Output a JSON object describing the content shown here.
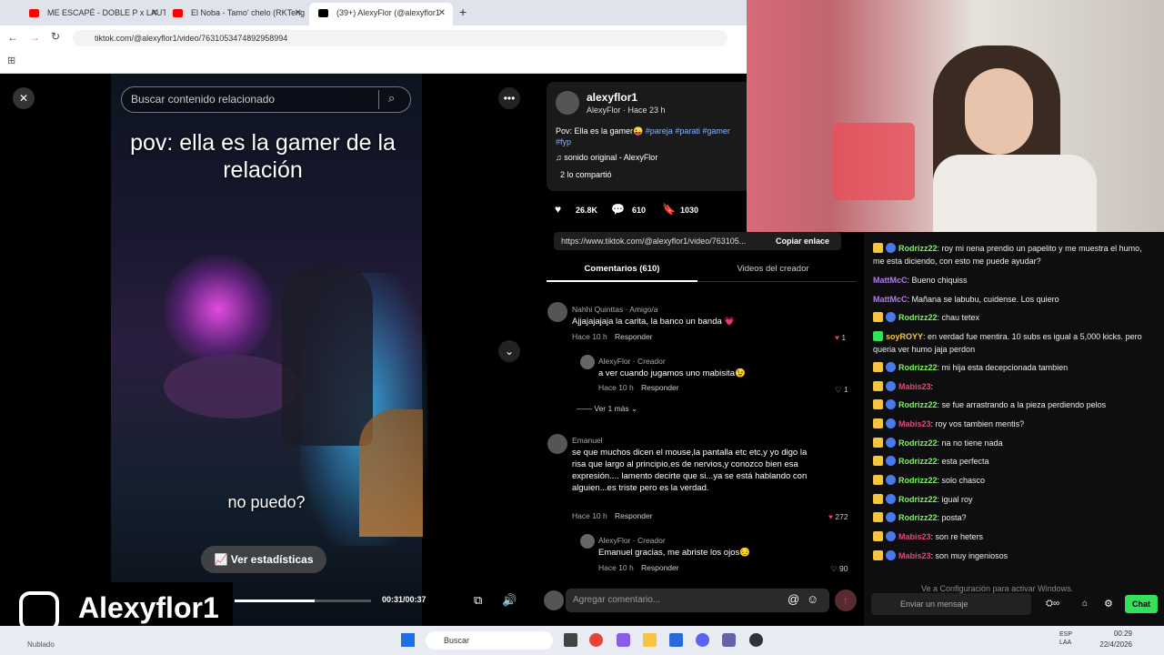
{
  "browser": {
    "tabs": [
      {
        "label": "ME ESCAPÉ - DOBLE P x LAUTY",
        "color": "#ff0000"
      },
      {
        "label": "El Noba - Tamo' chelo (RKTeng",
        "color": "#ff0000"
      },
      {
        "label": "(39+) AlexyFlor (@alexyflor1",
        "color": "#000000"
      }
    ],
    "url": "tiktok.com/@alexyflor1/video/7631053474892958994"
  },
  "tiktok": {
    "search_placeholder": "Buscar contenido relacionado",
    "video_caption": "pov: ella es la gamer de la relación",
    "video_subtitle": "no puedo?",
    "stats_button": "Ver estadísticas",
    "time": "00:31/00:37",
    "progress": 0.84,
    "author": {
      "name": "alexyflor1",
      "sub": "AlexyFlor · Hace 23 h"
    },
    "desc": "Pov: Ella es la gamer😜",
    "tags": [
      "#pareja",
      "#parati",
      "#gamer",
      "#fyp"
    ],
    "sound": "sonido original - AlexyFlor",
    "shared": "2 lo compartió",
    "likes": "26.8K",
    "comments": "610",
    "saves": "1030",
    "link": "https://www.tiktok.com/@alexyflor1/video/763105...",
    "copy_link": "Copiar enlace",
    "tab_comments": "Comentarios (610)",
    "tab_videos": "Videos del creador",
    "comment_list": [
      {
        "name": "Nahhi Quinttas · Amigo/a",
        "text": "Ajjajajajaja la carita, la banco un banda 💗",
        "time": "Hace 10 h",
        "reply": "Responder",
        "likes": "1"
      },
      {
        "name": "AlexyFlor · Creador",
        "text": "a ver cuando jugamos uno mabisita😉",
        "time": "Hace 10 h",
        "reply": "Responder",
        "likes": "1"
      },
      {
        "name": "Emanuel",
        "text": "se que muchos dicen el mouse,la pantalla etc etc,y yo digo la risa que largo al principio,es de nervios,y conozco bien esa expresión.... lamento decirte que si...ya se está hablando con alguien...es triste pero es la verdad.",
        "time": "Hace 10 h",
        "reply": "Responder",
        "likes": "272"
      },
      {
        "name": "AlexyFlor · Creador",
        "text": "Emanuel gracias, me abriste los ojos😔",
        "time": "Hace 10 h",
        "reply": "Responder",
        "likes": "90"
      }
    ],
    "more_replies": "Ver 1 más",
    "add_comment": "Agregar comentario..."
  },
  "overlay": {
    "handle": "Alexyflor1"
  },
  "chat": {
    "messages": [
      {
        "user": "Rodrizz22",
        "color": "#7cf45c",
        "text": ": roy mi nena prendio un papelito y me muestra el humo, me esta diciendo, con esto me puede ayudar?"
      },
      {
        "user": "MattMcC",
        "color": "#b37af0",
        "text": ": Bueno chiquiss"
      },
      {
        "user": "MattMcC",
        "color": "#b37af0",
        "text": ": Mañana se labubu, cuidense. Los quiero"
      },
      {
        "user": "Rodrizz22",
        "color": "#7cf45c",
        "text": ": chau tetex"
      },
      {
        "user": "soyROYY",
        "color": "#f5c842",
        "text": ": en verdad fue mentira. 10 subs es igual a 5,000 kicks. pero queria ver humo jaja perdon"
      },
      {
        "user": "Rodrizz22",
        "color": "#7cf45c",
        "text": ": mi hija esta decepcionada tambien"
      },
      {
        "user": "Mabis23",
        "color": "#e0497a",
        "text": ":"
      },
      {
        "user": "Rodrizz22",
        "color": "#7cf45c",
        "text": ": se fue arrastrando a la pieza perdiendo pelos"
      },
      {
        "user": "Mabis23",
        "color": "#e0497a",
        "text": ": roy vos tambien mentis?"
      },
      {
        "user": "Rodrizz22",
        "color": "#7cf45c",
        "text": ": na no tiene nada"
      },
      {
        "user": "Rodrizz22",
        "color": "#7cf45c",
        "text": ": esta perfecta"
      },
      {
        "user": "Rodrizz22",
        "color": "#7cf45c",
        "text": ": solo chasco"
      },
      {
        "user": "Rodrizz22",
        "color": "#7cf45c",
        "text": ": igual roy"
      },
      {
        "user": "Rodrizz22",
        "color": "#7cf45c",
        "text": ": posta?"
      },
      {
        "user": "Mabis23",
        "color": "#e0497a",
        "text": ": son re heters"
      },
      {
        "user": "Mabis23",
        "color": "#e0497a",
        "text": ": son muy ingeniosos"
      }
    ],
    "activate": "Ve a Configuración para activar Windows.",
    "input_placeholder": "Enviar un mensaje",
    "send": "Chat"
  },
  "taskbar": {
    "search": "Buscar",
    "lang": "ESP LAA",
    "time": "00:29",
    "date": "22/4/2026",
    "weather": "Nublado"
  }
}
